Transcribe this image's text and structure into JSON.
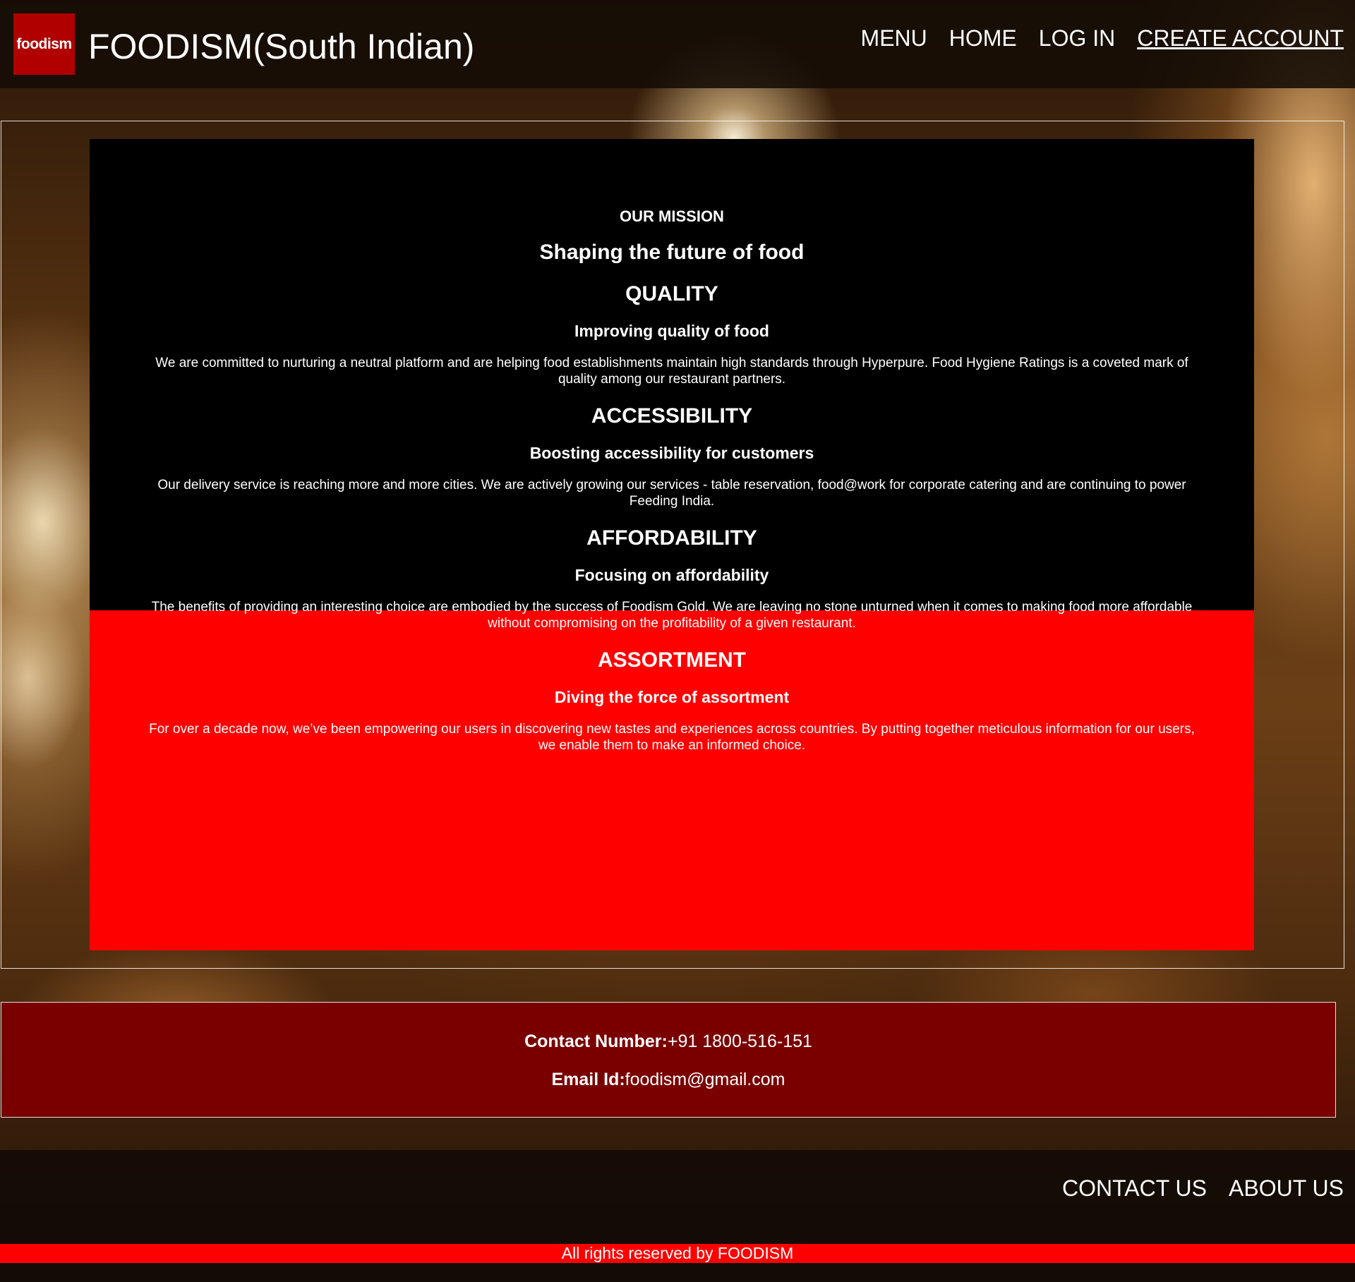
{
  "header": {
    "logo_text": "foodism",
    "title": "FOODISM(South Indian)",
    "nav": [
      {
        "label": "MENU"
      },
      {
        "label": "HOME"
      },
      {
        "label": "LOG IN"
      },
      {
        "label": "CREATE ACCOUNT"
      }
    ]
  },
  "mission": {
    "eyebrow": "OUR MISSION",
    "headline": "Shaping the future of food",
    "sections": [
      {
        "title": "QUALITY",
        "subtitle": "Improving quality of food",
        "body": "We are committed to nurturing a neutral platform and are helping food establishments maintain high standards through Hyperpure. Food Hygiene Ratings is a coveted mark of quality among our restaurant partners."
      },
      {
        "title": "ACCESSIBILITY",
        "subtitle": "Boosting accessibility for customers",
        "body": "Our delivery service is reaching more and more cities. We are actively growing our services - table reservation, food@work for corporate catering and are continuing to power Feeding India."
      },
      {
        "title": "AFFORDABILITY",
        "subtitle": "Focusing on affordability",
        "body": "The benefits of providing an interesting choice are embodied by the success of Foodism Gold. We are leaving no stone unturned when it comes to making food more affordable without compromising on the profitability of a given restaurant."
      },
      {
        "title": "ASSORTMENT",
        "subtitle": "Diving the force of assortment",
        "body": "For over a decade now, we’ve been empowering our users in discovering new tastes and experiences across countries. By putting together meticulous information for our users, we enable them to make an informed choice."
      }
    ]
  },
  "contact": {
    "phone_label": "Contact Number:",
    "phone_value": "+91 1800-516-151",
    "email_label": "Email Id:",
    "email_value": "foodism@gmail.com"
  },
  "footer": {
    "links": [
      {
        "label": "CONTACT US"
      },
      {
        "label": "ABOUT US"
      }
    ],
    "copyright": "All rights reserved by FOODISM"
  },
  "colors": {
    "brand_red": "#ff0000",
    "logo_red": "#b00000",
    "contact_bg": "#7a0000",
    "panel_top": "#000000"
  }
}
